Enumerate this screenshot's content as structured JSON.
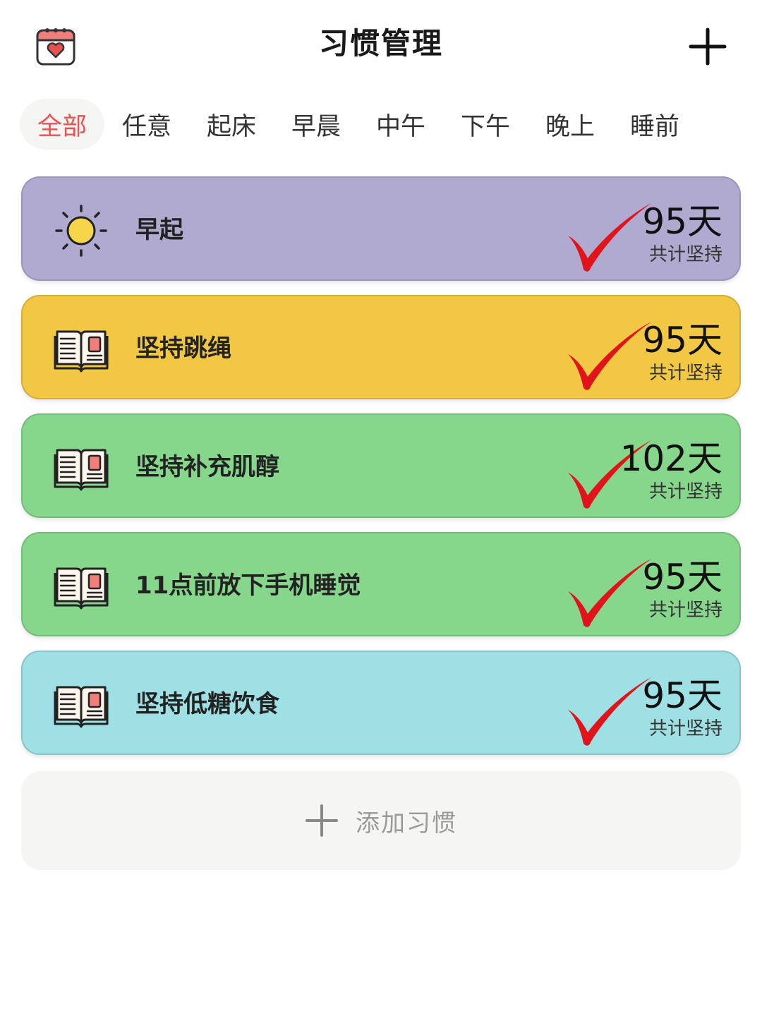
{
  "header": {
    "title": "习惯管理",
    "left_icon": "calendar-heart-icon",
    "right_icon": "plus-icon"
  },
  "tabs": [
    {
      "label": "全部",
      "active": true
    },
    {
      "label": "任意",
      "active": false
    },
    {
      "label": "起床",
      "active": false
    },
    {
      "label": "早晨",
      "active": false
    },
    {
      "label": "中午",
      "active": false
    },
    {
      "label": "下午",
      "active": false
    },
    {
      "label": "晚上",
      "active": false
    },
    {
      "label": "睡前",
      "active": false
    }
  ],
  "habits": [
    {
      "name": "早起",
      "days": "95天",
      "days_label": "共计坚持",
      "icon": "sun-icon",
      "color": "#b0aad1",
      "checked": true
    },
    {
      "name": "坚持跳绳",
      "days": "95天",
      "days_label": "共计坚持",
      "icon": "book-icon",
      "color": "#f2c744",
      "checked": true
    },
    {
      "name": "坚持补充肌醇",
      "days": "102天",
      "days_label": "共计坚持",
      "icon": "book-icon",
      "color": "#86d68c",
      "checked": true
    },
    {
      "name": "11点前放下手机睡觉",
      "days": "95天",
      "days_label": "共计坚持",
      "icon": "book-icon",
      "color": "#86d68c",
      "checked": true
    },
    {
      "name": "坚持低糖饮食",
      "days": "95天",
      "days_label": "共计坚持",
      "icon": "book-icon",
      "color": "#9ee0e4",
      "checked": true
    }
  ],
  "add_habit": {
    "label": "添加习惯",
    "icon": "plus-icon"
  },
  "colors": {
    "accent": "#e8524f",
    "check": "#e0141a"
  }
}
